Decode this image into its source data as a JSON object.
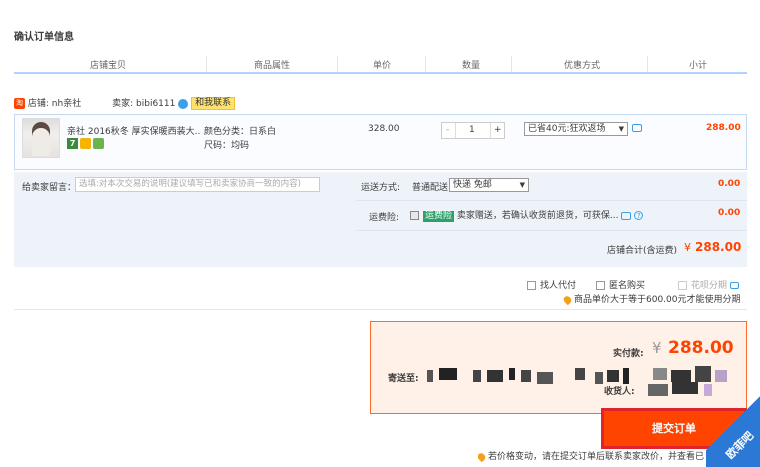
{
  "page_title": "确认订单信息",
  "columns": [
    "店铺宝贝",
    "商品属性",
    "单价",
    "数量",
    "优惠方式",
    "小计"
  ],
  "shop": {
    "shop_label": "店铺:",
    "shop_name": "nh亲社",
    "seller_label": "卖家:",
    "seller_name": "bibi6111",
    "contact_label": "和我联系",
    "tao_icon": "淘"
  },
  "item": {
    "title": "亲社 2016秋冬 厚实保暖西装大...",
    "attr_color": "颜色分类：日系白",
    "attr_size": "尺码：均码",
    "price": "328.00",
    "qty": "1",
    "qty_minus": "-",
    "qty_plus": "+",
    "discount": "已省40元:狂欢返场",
    "subtotal": "288.00",
    "badge_7": "7"
  },
  "shipping": {
    "memo_label": "给卖家留言：",
    "memo_placeholder": "选填:对本次交易的说明(建议填写已和卖家协商一致的内容)",
    "method_label": "运送方式:",
    "method_type": "普通配送",
    "method_select": "快递 免邮",
    "method_price": "0.00",
    "insurance_label": "运费险:",
    "insurance_tag": "运费险",
    "insurance_text": "卖家赠送，若确认收货前退货，可获保...",
    "insurance_price": "0.00",
    "store_total_label": "店铺合计(含运费)",
    "store_total_currency": "¥",
    "store_total": "288.00"
  },
  "options": {
    "agent_pay": "找人代付",
    "anonymous": "匿名购买",
    "installment": "花呗分期",
    "installment_note": "商品单价大于等于600.00元才能使用分期"
  },
  "payment": {
    "label": "实付款:",
    "currency": "¥",
    "amount": "288.00",
    "ship_to_label": "寄送至:",
    "receiver_label": "收货人:"
  },
  "submit_label": "提交订单",
  "footer_note": "若价格变动，请在提交订单后联系卖家改价，并查看已",
  "watermark": "欧菲吧",
  "colors": {
    "accent": "#ff4400",
    "border_blue": "#b2d1ff",
    "submit_outline": "#e0242a"
  }
}
